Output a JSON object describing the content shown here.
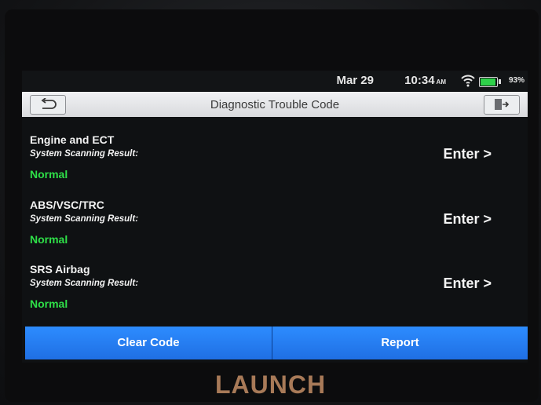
{
  "status_bar": {
    "date": "Mar 29",
    "time": "10:34",
    "ampm": "AM",
    "battery_percent": "93%",
    "battery_level": 0.93
  },
  "header": {
    "title": "Diagnostic Trouble Code"
  },
  "systems": [
    {
      "name": "Engine and ECT",
      "label": "System Scanning Result:",
      "result": "Normal",
      "action": "Enter >"
    },
    {
      "name": "ABS/VSC/TRC",
      "label": "System Scanning Result:",
      "result": "Normal",
      "action": "Enter >"
    },
    {
      "name": "SRS Airbag",
      "label": "System Scanning Result:",
      "result": "Normal",
      "action": "Enter >"
    }
  ],
  "footer": {
    "clear_label": "Clear Code",
    "report_label": "Report"
  },
  "brand": "LAUNCH",
  "colors": {
    "accent": "#2d8cff",
    "status_ok": "#2ee048",
    "battery": "#2fd14a"
  },
  "icons": {
    "back": "back-arrow-icon",
    "exit": "exit-icon",
    "wifi": "wifi-icon",
    "battery": "battery-icon"
  }
}
